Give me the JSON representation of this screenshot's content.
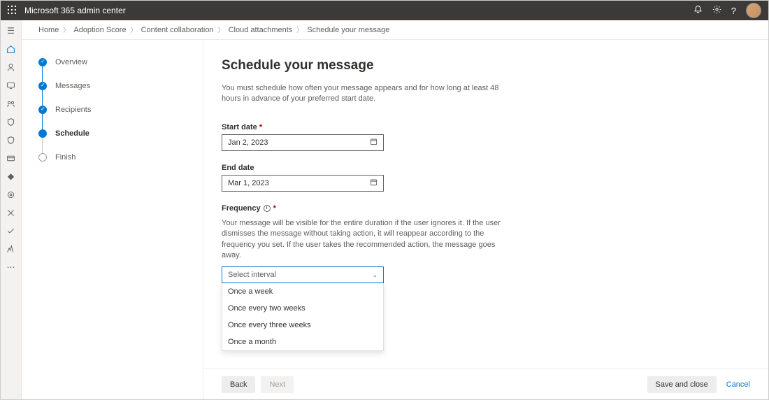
{
  "header": {
    "title": "Microsoft 365 admin center"
  },
  "breadcrumb": {
    "items": [
      "Home",
      "Adoption Score",
      "Content collaboration",
      "Cloud attachments",
      "Schedule your message"
    ]
  },
  "stepper": {
    "items": [
      {
        "label": "Overview",
        "state": "done"
      },
      {
        "label": "Messages",
        "state": "done"
      },
      {
        "label": "Recipients",
        "state": "done"
      },
      {
        "label": "Schedule",
        "state": "active"
      },
      {
        "label": "Finish",
        "state": "pending"
      }
    ]
  },
  "page": {
    "title": "Schedule your message",
    "intro": "You must schedule how often your message appears and for how long at least 48 hours in advance of your preferred start date."
  },
  "fields": {
    "start_label": "Start date",
    "start_value": "Jan 2, 2023",
    "end_label": "End date",
    "end_value": "Mar 1, 2023",
    "freq_label": "Frequency",
    "freq_help": "Your message will be visible for the entire duration if the user ignores it. If the user dismisses the message without taking action, it will reappear according to the frequency you set. If the user takes the recommended action, the message goes away.",
    "freq_placeholder": "Select interval",
    "freq_options": [
      "Once a week",
      "Once every two weeks",
      "Once every three weeks",
      "Once a month"
    ]
  },
  "footer": {
    "back": "Back",
    "next": "Next",
    "save": "Save and close",
    "cancel": "Cancel"
  }
}
